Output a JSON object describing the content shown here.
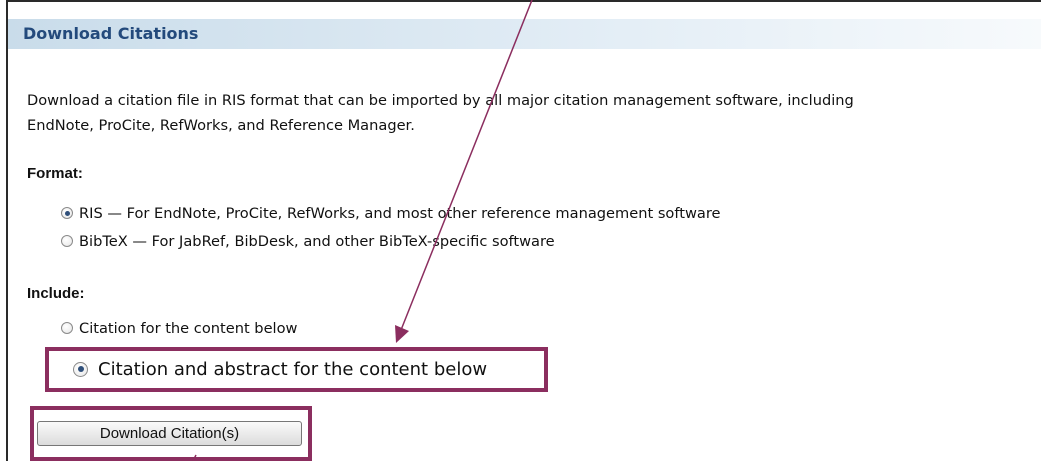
{
  "header": {
    "title": "Download Citations"
  },
  "intro": {
    "line1": "Download a citation file in RIS format that can be imported by all major citation management software, including",
    "line2": "EndNote, ProCite, RefWorks, and Reference Manager."
  },
  "format": {
    "label": "Format:",
    "options": [
      {
        "label": "RIS — For EndNote, ProCite, RefWorks, and most other reference management software",
        "checked": true
      },
      {
        "label": "BibTeX — For JabRef, BibDesk, and other BibTeX-specific software",
        "checked": false
      }
    ]
  },
  "include": {
    "label": "Include:",
    "options": [
      {
        "label": "Citation for the content below",
        "checked": false
      },
      {
        "label": "Citation and abstract for the content below",
        "checked": true
      }
    ]
  },
  "download_button": {
    "label": "Download Citation(s)"
  },
  "annotation": {
    "highlight_color": "#8b2e5f",
    "arrow_color": "#8b2e5f"
  }
}
